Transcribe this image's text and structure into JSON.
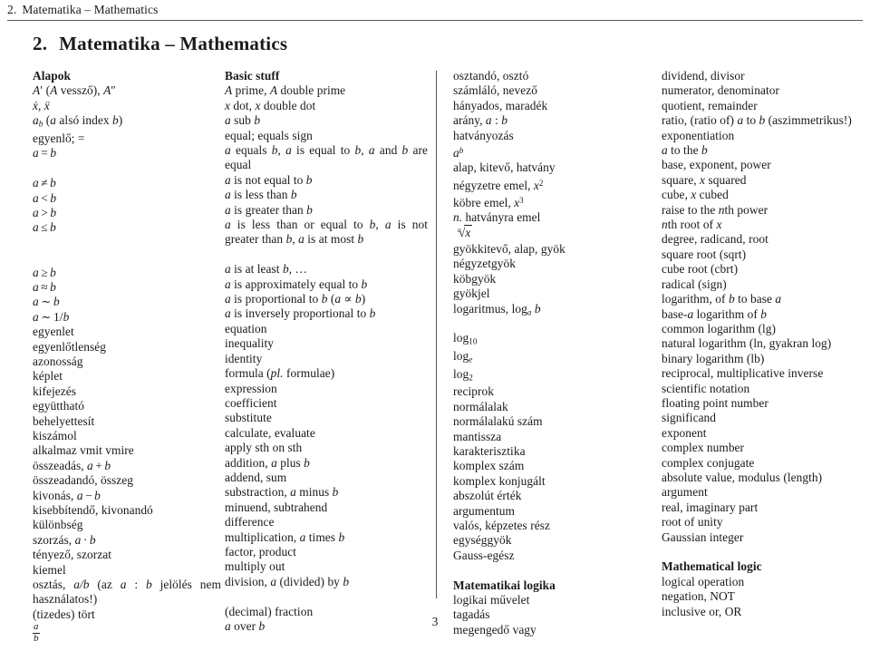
{
  "running_header": {
    "number": "2.",
    "title": "Matematika – Mathematics"
  },
  "section_title": {
    "number": "2.",
    "text": "Matematika – Mathematics"
  },
  "page_number": "3",
  "columns": {
    "left_hu": [
      "Alapok",
      "A′ (A vessző), A″",
      "ẋ, ẍ",
      "a_b (a alsó index b)",
      "egyenlő; =",
      "a = b",
      "",
      "a ≠ b",
      "a < b",
      "a > b",
      "a ≤ b",
      "",
      "a ≥ b",
      "a ≈ b",
      "a ∼ b",
      "a ∼ 1/b",
      "egyenlet",
      "egyenlőtlenség",
      "azonosság",
      "képlet",
      "kifejezés",
      "együttható",
      "behelyettesít",
      "kiszámol",
      "alkalmaz vmit vmire",
      "összeadás, a + b",
      "összeadandó, összeg",
      "kivonás, a − b",
      "kisebbítendő, kivonandó",
      "különbség",
      "szorzás, a · b",
      "tényező, szorzat",
      "kiemel",
      "osztás, a/b (az a : b jelölés nem használatos!)",
      "(tizedes) tört",
      "a/b"
    ],
    "left_en": [
      "Basic stuff",
      "A prime, A double prime",
      "x dot, x double dot",
      "a sub b",
      "equal; equals sign",
      "a equals b, a is equal to b, a and b are equal",
      "a is not equal to b",
      "a is less than b",
      "a is greater than b",
      "a is less than or equal to b, a is not greater than b, a is at most b",
      "a is at least b, …",
      "a is approximately equal to b",
      "a is proportional to b (a ∝ b)",
      "a is inversely proportional to b",
      "equation",
      "inequality",
      "identity",
      "formula (pl. formulae)",
      "expression",
      "coefficient",
      "substitute",
      "calculate, evaluate",
      "apply sth on sth",
      "addition, a plus b",
      "addend, sum",
      "substraction, a minus b",
      "minuend, subtrahend",
      "difference",
      "multiplication, a times b",
      "factor, product",
      "multiply out",
      "division, a (divided) by b",
      "",
      "(decimal) fraction",
      "a over b"
    ],
    "right_hu": [
      "osztandó, osztó",
      "számláló, nevező",
      "hányados, maradék",
      "arány, a : b",
      "hatványozás",
      "a^b",
      "alap, kitevő, hatvány",
      "négyzetre emel, x²",
      "köbre emel, x³",
      "n. hatványra emel",
      "ⁿ√x",
      "gyökkitevő, alap, gyök",
      "négyzetgyök",
      "köbgyök",
      "gyökjel",
      "logaritmus, log_a b",
      "",
      "log₁₀",
      "log_e",
      "log₂",
      "reciprok",
      "normálalak",
      "normálalakú szám",
      "mantissza",
      "karakterisztika",
      "komplex szám",
      "komplex konjugált",
      "abszolút érték",
      "argumentum",
      "valós, képzetes rész",
      "egységgyök",
      "Gauss-egész",
      "",
      "Matematikai logika",
      "logikai művelet",
      "tagadás",
      "megengedő vagy"
    ],
    "right_en": [
      "dividend, divisor",
      "numerator, denominator",
      "quotient, remainder",
      "ratio, (ratio of) a to b (aszimmetrikus!)",
      "exponentiation",
      "a to the b",
      "base, exponent, power",
      "square, x squared",
      "cube, x cubed",
      "raise to the nth power",
      "nth root of x",
      "degree, radicand, root",
      "square root (sqrt)",
      "cube root (cbrt)",
      "radical (sign)",
      "logarithm, of b to base a",
      "base-a logarithm of b",
      "common logarithm (lg)",
      "natural logarithm (ln, gyakran log)",
      "binary logarithm (lb)",
      "reciprocal, multiplicative inverse",
      "scientific notation",
      "floating point number",
      "significand",
      "exponent",
      "complex number",
      "complex conjugate",
      "absolute value, modulus (length)",
      "argument",
      "real, imaginary part",
      "root of unity",
      "Gaussian integer",
      "",
      "Mathematical logic",
      "logical operation",
      "negation, NOT",
      "inclusive or, OR"
    ]
  }
}
